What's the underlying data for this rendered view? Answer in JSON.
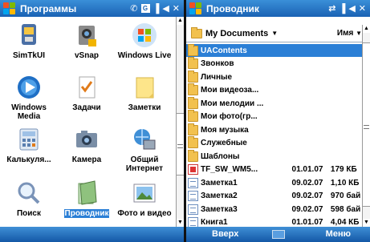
{
  "left": {
    "title": "Программы",
    "items": [
      {
        "label": "SimTkUI",
        "icon": "sim-toolkit-icon"
      },
      {
        "label": "vSnap",
        "icon": "camera-snap-icon"
      },
      {
        "label": "Windows Live",
        "icon": "windows-live-icon"
      },
      {
        "label": "Windows Media",
        "icon": "windows-media-icon"
      },
      {
        "label": "Задачи",
        "icon": "tasks-icon"
      },
      {
        "label": "Заметки",
        "icon": "notes-icon"
      },
      {
        "label": "Калькуля...",
        "icon": "calculator-icon"
      },
      {
        "label": "Камера",
        "icon": "camera-icon"
      },
      {
        "label": "Общий Интернет",
        "icon": "internet-sharing-icon"
      },
      {
        "label": "Поиск",
        "icon": "search-icon"
      },
      {
        "label": "Проводник",
        "icon": "file-explorer-icon"
      },
      {
        "label": "Фото и видео",
        "icon": "photos-icon"
      }
    ],
    "selected_label": "Проводник",
    "softkeys": {
      "left": "",
      "right": ""
    }
  },
  "right": {
    "title": "Проводник",
    "folder_label": "My Documents",
    "sort_label": "Имя",
    "rows": [
      {
        "name": "UAContents",
        "date": "",
        "size": "",
        "type": "folder"
      },
      {
        "name": "Звонков",
        "date": "",
        "size": "",
        "type": "folder"
      },
      {
        "name": "Личные",
        "date": "",
        "size": "",
        "type": "folder"
      },
      {
        "name": "Мои видеоза...",
        "date": "",
        "size": "",
        "type": "folder"
      },
      {
        "name": "Мои мелодии ...",
        "date": "",
        "size": "",
        "type": "folder"
      },
      {
        "name": "Мои фото(гр...",
        "date": "",
        "size": "",
        "type": "folder"
      },
      {
        "name": "Моя музыка",
        "date": "",
        "size": "",
        "type": "folder"
      },
      {
        "name": "Служебные",
        "date": "",
        "size": "",
        "type": "folder"
      },
      {
        "name": "Шаблоны",
        "date": "",
        "size": "",
        "type": "folder"
      },
      {
        "name": "TF_SW_WM5...",
        "date": "01.01.07",
        "size": "179 КБ",
        "type": "pdf"
      },
      {
        "name": "Заметка1",
        "date": "09.02.07",
        "size": "1,10 КБ",
        "type": "doc"
      },
      {
        "name": "Заметка2",
        "date": "09.02.07",
        "size": "970 бай",
        "type": "doc"
      },
      {
        "name": "Заметка3",
        "date": "09.02.07",
        "size": "598 бай",
        "type": "doc"
      },
      {
        "name": "Книга1",
        "date": "01.01.07",
        "size": "4,04 КБ",
        "type": "doc"
      }
    ],
    "softkeys": {
      "left": "Вверх",
      "right": "Меню"
    }
  },
  "colors": {
    "titlebar": "#1a62b4",
    "selection": "#2b7fd6",
    "folder": "#f2c14e"
  }
}
